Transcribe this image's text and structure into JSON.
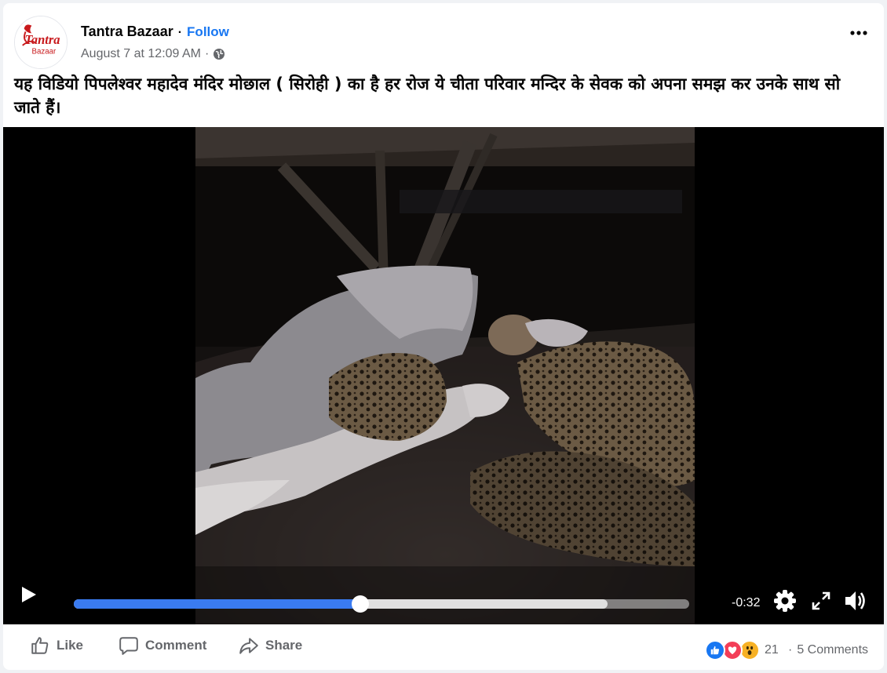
{
  "post": {
    "page_name": "Tantra Bazaar",
    "separator": "·",
    "follow_label": "Follow",
    "timestamp": "August 7 at 12:09 AM",
    "meta_dot": "·",
    "audience_icon": "globe-icon",
    "more_icon": "more-options-icon",
    "caption": "यह विडियो पिपलेश्वर महादेव मंदिर मोछाल ( सिरोही ) का है हर रोज ये चीता परिवार मन्दिर के सेवक को अपना समझ कर उनके साथ सो जाते हैं।"
  },
  "avatar": {
    "logo_line1": "Tantra",
    "logo_line2": "Bazaar"
  },
  "video": {
    "remaining_time": "-0:32",
    "progress": 0.466,
    "buffered": 0.867,
    "icons": [
      "play-icon",
      "settings-icon",
      "fullscreen-icon",
      "volume-icon"
    ]
  },
  "footer": {
    "like_label": "Like",
    "comment_label": "Comment",
    "share_label": "Share",
    "reaction_icons": [
      "like-reaction-icon",
      "love-reaction-icon",
      "wow-reaction-icon"
    ],
    "reaction_count": "21",
    "comments_count": "5 Comments",
    "colors": {
      "like": "#1877f2",
      "love": "#f33e58",
      "wow": "#f7b125"
    }
  },
  "colors": {
    "accent": "#1877f2",
    "progress_fill": "#3a7bf0",
    "secondary_text": "#65676b"
  }
}
